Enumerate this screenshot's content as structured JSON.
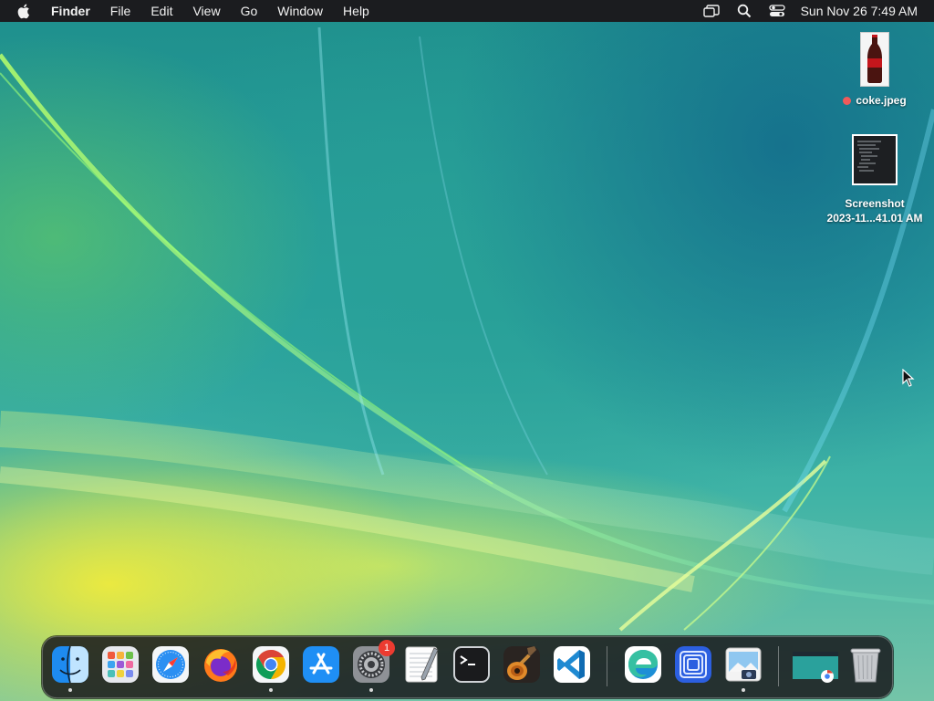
{
  "menubar": {
    "app_name": "Finder",
    "menus": [
      "File",
      "Edit",
      "View",
      "Go",
      "Window",
      "Help"
    ],
    "status_icons": [
      "screen-mirroring-icon",
      "search-icon",
      "control-center-icon"
    ],
    "clock": "Sun Nov 26  7:49 AM"
  },
  "desktop": {
    "items": [
      {
        "label": "coke.jpeg",
        "tag_color": "#f05a5a"
      },
      {
        "label_line1": "Screenshot",
        "label_line2": "2023-11...41.01 AM"
      }
    ]
  },
  "dock": {
    "apps": [
      {
        "name": "Finder",
        "running": true
      },
      {
        "name": "Launchpad",
        "running": false
      },
      {
        "name": "Safari",
        "running": false
      },
      {
        "name": "Firefox",
        "running": false
      },
      {
        "name": "Google Chrome",
        "running": true
      },
      {
        "name": "App Store",
        "running": false
      },
      {
        "name": "System Settings",
        "running": true,
        "badge": "1"
      },
      {
        "name": "TextEdit",
        "running": false
      },
      {
        "name": "Terminal",
        "running": false
      },
      {
        "name": "GarageBand",
        "running": false
      },
      {
        "name": "Visual Studio Code",
        "running": false
      },
      {
        "name": "Microsoft Edge",
        "running": false
      },
      {
        "name": "Simulator",
        "running": false
      },
      {
        "name": "Preview",
        "running": true
      },
      {
        "name": "Chrome window",
        "running": false
      },
      {
        "name": "Trash",
        "running": false
      }
    ]
  },
  "colors": {
    "menubar": "#1b1c1f",
    "badge": "#ec3b30",
    "tag": "#f05a5a"
  }
}
